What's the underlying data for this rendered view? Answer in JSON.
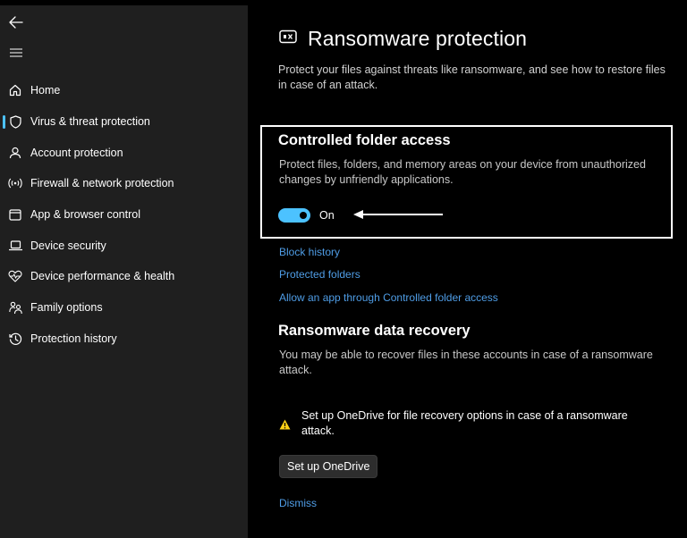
{
  "sidebar": {
    "back_icon": "back-arrow-icon",
    "menu_icon": "hamburger-menu-icon",
    "items": [
      {
        "label": "Home",
        "icon": "home-icon"
      },
      {
        "label": "Virus & threat protection",
        "icon": "shield-icon",
        "selected": true
      },
      {
        "label": "Account protection",
        "icon": "person-icon"
      },
      {
        "label": "Firewall & network protection",
        "icon": "wireless-signal-icon"
      },
      {
        "label": "App & browser control",
        "icon": "browser-window-icon"
      },
      {
        "label": "Device security",
        "icon": "laptop-icon"
      },
      {
        "label": "Device performance & health",
        "icon": "heart-pulse-icon"
      },
      {
        "label": "Family options",
        "icon": "family-icon"
      },
      {
        "label": "Protection history",
        "icon": "history-icon"
      }
    ]
  },
  "main": {
    "title": "Ransomware protection",
    "title_icon": "ransomware-icon",
    "description": "Protect your files against threats like ransomware, and see how to restore files in case of an attack.",
    "cfa": {
      "heading": "Controlled folder access",
      "description": "Protect files, folders, and memory areas on your device from unauthorized changes by unfriendly applications.",
      "toggle_on": true,
      "toggle_label": "On"
    },
    "links": [
      "Block history",
      "Protected folders",
      "Allow an app through Controlled folder access"
    ],
    "recovery": {
      "heading": "Ransomware data recovery",
      "description": "You may be able to recover files in these accounts in case of a ransomware attack.",
      "warning_icon": "warning-triangle-icon",
      "warning_text": "Set up OneDrive for file recovery options in case of a ransomware attack.",
      "button_label": "Set up OneDrive",
      "dismiss_label": "Dismiss"
    }
  },
  "colors": {
    "accent": "#4cc2ff",
    "link": "#4f9de6",
    "sidebar_bg": "#1f1f1f",
    "main_bg": "#000000",
    "warning": "#fcd116"
  }
}
